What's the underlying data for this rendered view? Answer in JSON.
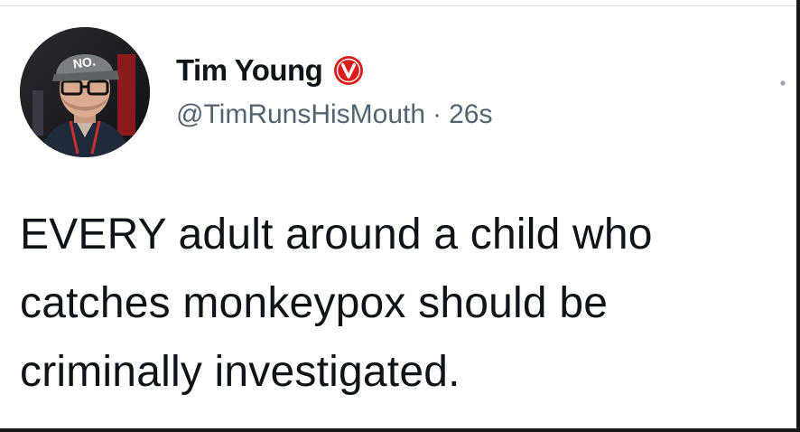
{
  "tweet": {
    "author": {
      "display_name": "Tim Young",
      "handle": "@TimRunsHisMouth",
      "verified_icon": "verified-badge-icon",
      "verified_color": "#d91c1c",
      "avatar_cap_text": "NO."
    },
    "separator": "·",
    "timestamp": "26s",
    "text": "EVERY adult around a child who catches monkeypox should be criminally investigated.",
    "more_icon": "more-options-icon"
  }
}
